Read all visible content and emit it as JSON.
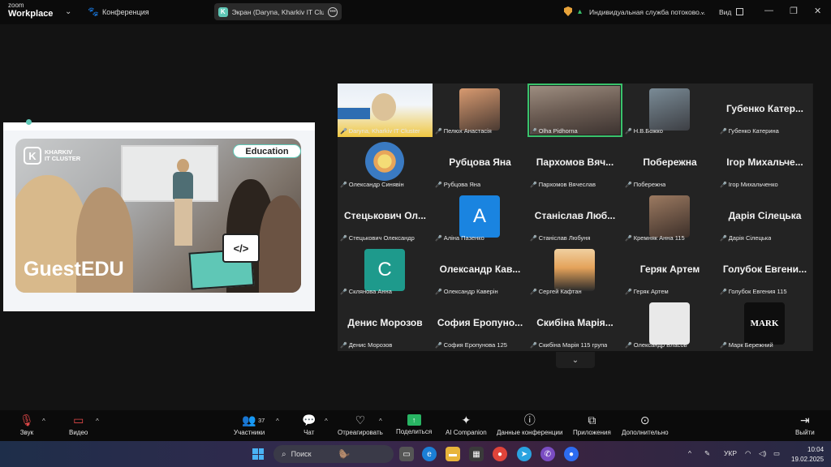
{
  "titlebar": {
    "logo_line1": "zoom",
    "logo_line2": "Workplace",
    "conference_label": "Конференция",
    "share_title": "Экран (Daryna, Kharkiv IT Cluster)",
    "stream_label": "Индивидуальная служба потоково...",
    "view_label": "Вид"
  },
  "shared_slide": {
    "logo_line1": "KHARKIV",
    "logo_line2": "IT CLUSTER",
    "badge": "Education",
    "title": "GuestEDU",
    "code_symbol": "</>"
  },
  "gallery": {
    "tiles": [
      {
        "label": "Daryna, Kharkiv IT Cluster",
        "kind": "share"
      },
      {
        "label": "Пелюх Анастасія",
        "kind": "photo-warm"
      },
      {
        "label": "Olha Pidhorna",
        "kind": "camera",
        "selected": true
      },
      {
        "label": "Н.В.Божко",
        "kind": "photo"
      },
      {
        "label": "Губенко Катерина",
        "big": "Губенко Катер..."
      },
      {
        "label": "Олександр Синявін",
        "kind": "emblem"
      },
      {
        "label": "Рубцова Яна",
        "big": "Рубцова Яна"
      },
      {
        "label": "Пархомов Вячеслав",
        "big": "Пархомов Вяч..."
      },
      {
        "label": "Побережна",
        "big": "Побережна"
      },
      {
        "label": "Ігор Михальченко",
        "big": "Ігор Михальче..."
      },
      {
        "label": "Стецькович Олександр",
        "big": "Стецькович Ол..."
      },
      {
        "label": "Аліна Пазенко",
        "kind": "letter",
        "letter": "A",
        "color": "#1a84e0"
      },
      {
        "label": "Станіслав Любуня",
        "big": "Станіслав Люб..."
      },
      {
        "label": "Кремняк Анна 115",
        "kind": "anime"
      },
      {
        "label": "Дарія Сілецька",
        "big": "Дарія Сілецька"
      },
      {
        "label": "Склянова Анна",
        "kind": "letter",
        "letter": "C",
        "color": "#1e9a8c"
      },
      {
        "label": "Олександр Каверін",
        "big": "Олександр Кав..."
      },
      {
        "label": "Сергей Кафтан",
        "kind": "sunset"
      },
      {
        "label": "Геряк Артем",
        "big": "Геряк Артем"
      },
      {
        "label": "Голубок Евгения 115",
        "big": "Голубок Евгени..."
      },
      {
        "label": "Денис Морозов",
        "big": "Денис Морозов"
      },
      {
        "label": "София Еропунова 125",
        "big": "София Еропуно..."
      },
      {
        "label": "Скибіна Марія 115 група",
        "big": "Скибіна Марія..."
      },
      {
        "label": "Олександр Власов",
        "kind": "sketch"
      },
      {
        "label": "Марк Бережний",
        "kind": "mark",
        "letter": "MARK"
      }
    ]
  },
  "toolbar": {
    "audio": "Звук",
    "video": "Видео",
    "participants": "Участники",
    "participants_count": "37",
    "chat": "Чат",
    "react": "Отреагировать",
    "share": "Поделиться",
    "ai": "AI Companion",
    "info": "Данные конференции",
    "apps": "Приложения",
    "more": "Дополнительно",
    "leave": "Выйти"
  },
  "taskbar": {
    "search_placeholder": "Поиск",
    "language": "УКР",
    "time": "10:04",
    "date": "19.02.2025"
  },
  "colors": {
    "accent_green": "#39c26b",
    "share_green": "#28b463",
    "brand_teal": "#5fc7b6",
    "muted_red": "#e04848"
  }
}
